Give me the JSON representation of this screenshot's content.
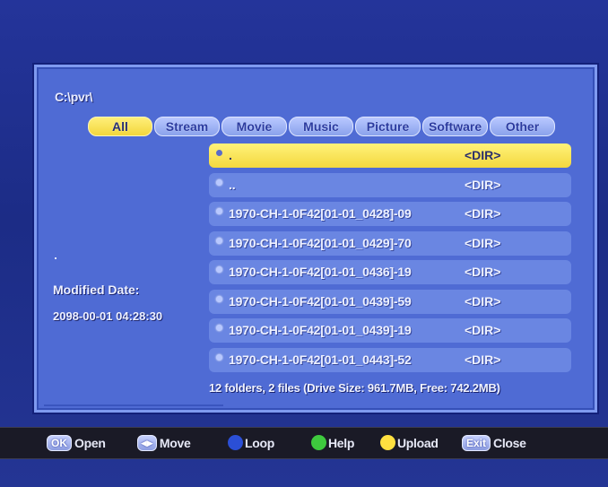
{
  "path": "C:\\pvr\\",
  "tabs": [
    {
      "label": "All",
      "active": true
    },
    {
      "label": "Stream",
      "active": false
    },
    {
      "label": "Movie",
      "active": false
    },
    {
      "label": "Music",
      "active": false
    },
    {
      "label": "Picture",
      "active": false
    },
    {
      "label": "Software",
      "active": false
    },
    {
      "label": "Other",
      "active": false
    }
  ],
  "details": {
    "marker": ".",
    "modified_label": "Modified Date:",
    "modified_value": "2098-00-01 04:28:30"
  },
  "files": [
    {
      "name": ".",
      "type": "<DIR>",
      "selected": true
    },
    {
      "name": "..",
      "type": "<DIR>",
      "selected": false
    },
    {
      "name": "1970-CH-1-0F42[01-01_0428]-09",
      "type": "<DIR>",
      "selected": false
    },
    {
      "name": "1970-CH-1-0F42[01-01_0429]-70",
      "type": "<DIR>",
      "selected": false
    },
    {
      "name": "1970-CH-1-0F42[01-01_0436]-19",
      "type": "<DIR>",
      "selected": false
    },
    {
      "name": "1970-CH-1-0F42[01-01_0439]-59",
      "type": "<DIR>",
      "selected": false
    },
    {
      "name": "1970-CH-1-0F42[01-01_0439]-19",
      "type": "<DIR>",
      "selected": false
    },
    {
      "name": "1970-CH-1-0F42[01-01_0443]-52",
      "type": "<DIR>",
      "selected": false
    }
  ],
  "summary": "12 folders, 2 files (Drive Size: 961.7MB, Free: 742.2MB)",
  "footer": {
    "ok_key": "OK",
    "open": "Open",
    "move_key": "◀▶",
    "move": "Move",
    "loop": "Loop",
    "help": "Help",
    "upload": "Upload",
    "exit_key": "Exit",
    "close": "Close"
  },
  "colors": {
    "loop_button": "#2b4fd6",
    "help_button": "#3ec93e",
    "upload_button": "#ffe040"
  }
}
